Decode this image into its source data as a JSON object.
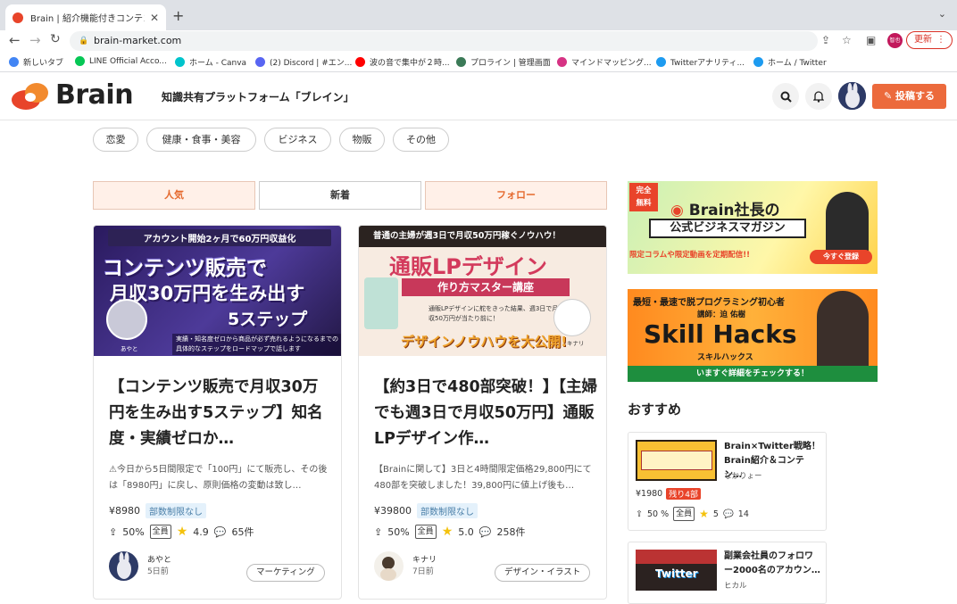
{
  "browser": {
    "tab_title": "Brain | 紹介機能付きコンテンツ販",
    "url": "brain-market.com",
    "update_label": "更新",
    "profile_initials": "智也",
    "bookmarks": [
      {
        "label": "新しいタブ",
        "color": "#4285f4"
      },
      {
        "label": "LINE Official Acco...",
        "color": "#06c755"
      },
      {
        "label": "ホーム - Canva",
        "color": "#00c4cc"
      },
      {
        "label": "(2) Discord | #エン...",
        "color": "#5865f2"
      },
      {
        "label": "波の音で集中が２時...",
        "color": "#ff0000"
      },
      {
        "label": "プロライン | 管理画面",
        "color": "#3b7a57"
      },
      {
        "label": "マインドマッピング...",
        "color": "#d63384"
      },
      {
        "label": "Twitterアナリティ...",
        "color": "#1d9bf0"
      },
      {
        "label": "ホーム / Twitter",
        "color": "#1d9bf0"
      }
    ]
  },
  "header": {
    "logo_text": "Brain",
    "tagline": "知識共有プラットフォーム「ブレイン」",
    "post_label": "投稿する"
  },
  "categories": [
    "恋愛",
    "健康・食事・美容",
    "ビジネス",
    "物販",
    "その他"
  ],
  "sort_tabs": [
    "人気",
    "新着",
    "フォロー"
  ],
  "cards": [
    {
      "banner_line1": "アカウント開始2ヶ月で60万円収益化",
      "banner_line2": "コンテンツ販売で",
      "banner_line3": "月収30万円を生み出す",
      "banner_line4": "5ステップ",
      "banner_foot": "実績・知名度ゼロから商品が必ず売れるようになるまでの具体的なステップをロードマップで話します",
      "banner_name": "あやと",
      "title": "【コンテンツ販売で月収30万円を生み出す5ステップ】知名度・実績ゼロか…",
      "desc": "⚠今日から5日間限定で「100円」にて販売し、その後は「8980円」に戻し、原則価格の変動は致し…",
      "price": "¥8980",
      "limit": "部数制限なし",
      "share": "50%",
      "all": "全員",
      "rating": "4.9",
      "comments": "65件",
      "author": "あやと",
      "date": "5日前",
      "tag": "マーケティング"
    },
    {
      "banner_line1": "普通の主婦が週3日で月収50万円稼ぐノウハウ！",
      "banner_line2": "通販LPデザイン",
      "banner_line3": "作り方マスター講座",
      "banner_line4": "デザインノウハウを大公開!",
      "banner_foot": "通販LPデザインに舵をきった結果、週3日で月収50万円が当たり前に！",
      "banner_name": "キナリ",
      "title": "【約3日で480部突破！】【主婦でも週3日で月収50万円】通販LPデザイン作…",
      "desc": "【Brainに関して】3日と4時間限定価格29,800円にて480部を突破しました！39,800円に値上げ後も…",
      "price": "¥39800",
      "limit": "部数制限なし",
      "share": "50%",
      "all": "全員",
      "rating": "5.0",
      "comments": "258件",
      "author": "キナリ",
      "date": "7日前",
      "tag": "デザイン・イラスト"
    }
  ],
  "ads": [
    {
      "badge_line1": "完全",
      "badge_line2": "無料",
      "title1": "Brain社長の",
      "title2": "公式ビジネスマガジン",
      "sub": "限定コラムや限定動画を定期配信!!",
      "cta": "今すぐ登録"
    },
    {
      "top": "最短・最速で脱プログラミング初心者",
      "lecturer": "講師：迫 佑樹",
      "title": "Skill Hacks",
      "kana": "スキルハックス",
      "cta": "いますぐ詳細をチェックする！"
    }
  ],
  "recommend": {
    "heading": "おすすめ",
    "items": [
      {
        "title": "Brain×Twitter戦略！Brain紹介＆コンテン…",
        "author": "なかりょー",
        "price": "¥1980",
        "remain": "残り4部",
        "share": "50 %",
        "all": "全員",
        "rating": "5",
        "comments": "14"
      },
      {
        "title": "副業会社員のフォロワー2000名のアカウン…",
        "author": "ヒカル",
        "thumb": "Twitter"
      }
    ]
  }
}
